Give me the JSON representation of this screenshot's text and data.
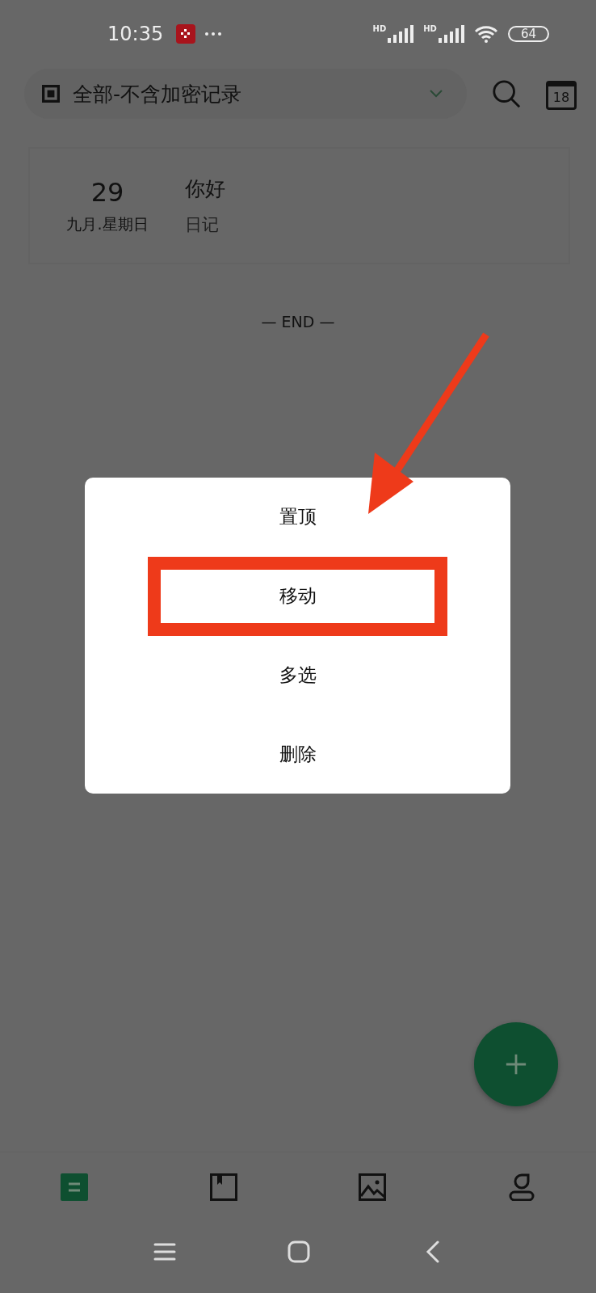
{
  "status_bar": {
    "time": "10:35",
    "battery": "64"
  },
  "header": {
    "filter": "全部-不含加密记录",
    "calendar_day": "18"
  },
  "signal_labels": [
    "HD",
    "HD"
  ],
  "entries": [
    {
      "day": "29",
      "date": "九月.星期日",
      "title": "你好",
      "category": "日记"
    }
  ],
  "end_label": "— END —",
  "context_menu": [
    {
      "label": "置顶",
      "highlighted": false
    },
    {
      "label": "移动",
      "highlighted": true
    },
    {
      "label": "多选",
      "highlighted": false
    },
    {
      "label": "删除",
      "highlighted": false
    }
  ],
  "bottom_nav": [
    {
      "kind": "list",
      "selected": true
    },
    {
      "kind": "book",
      "selected": false
    },
    {
      "kind": "image",
      "selected": false
    },
    {
      "kind": "person",
      "selected": false
    }
  ]
}
